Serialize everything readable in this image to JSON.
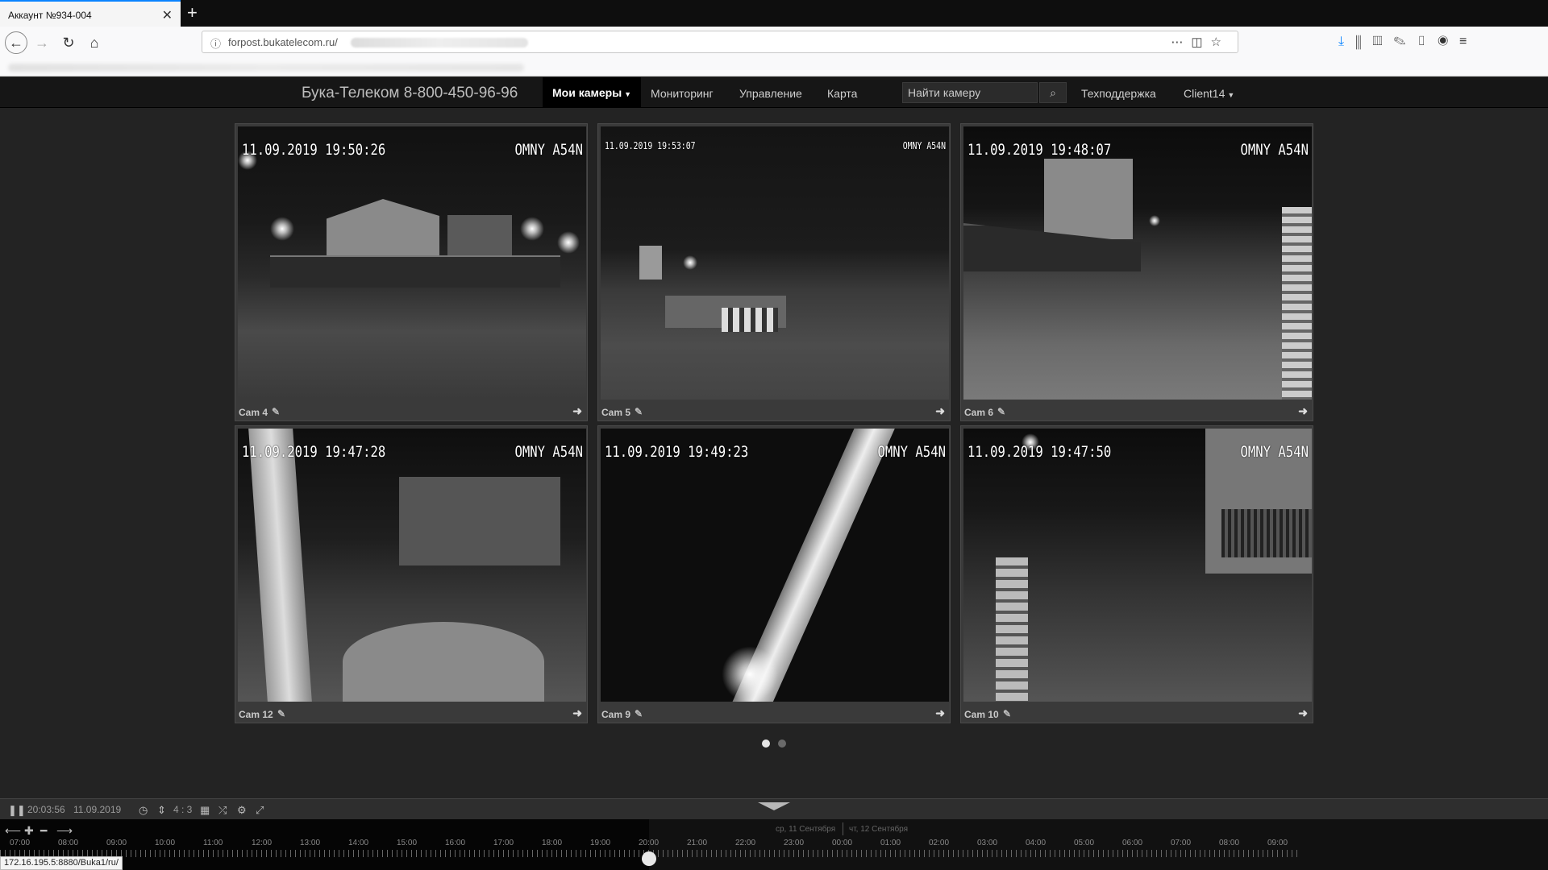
{
  "browser": {
    "tab_title": "Аккаунт №934-004",
    "tab_close": "✕",
    "new_tab": "+",
    "url": "forpost.bukatelecom.ru/",
    "icons": [
      "back-icon",
      "forward-icon",
      "reload-icon",
      "home-icon",
      "info-icon",
      "more-icon",
      "pocket-icon",
      "star-icon",
      "download-icon",
      "library-icon",
      "sidebar-icon",
      "extension-icon",
      "clipboard-icon",
      "account-icon",
      "menu-icon"
    ]
  },
  "navbar": {
    "brand": "Бука-Телеком 8-800-450-96-96",
    "my_cameras": "Мои камеры",
    "monitoring": "Мониторинг",
    "management": "Управление",
    "map": "Карта",
    "search_placeholder": "Найти камеру",
    "support": "Техподдержка",
    "user": "Client14"
  },
  "cameras": [
    {
      "name": "Cam 4",
      "timestamp": "11.09.2019 19:50:26",
      "model": "OMNY A54N"
    },
    {
      "name": "Cam 5",
      "timestamp": "11.09.2019 19:53:07",
      "model": "OMNY A54N"
    },
    {
      "name": "Cam 6",
      "timestamp": "11.09.2019 19:48:07",
      "model": "OMNY A54N"
    },
    {
      "name": "Cam 12",
      "timestamp": "11.09.2019 19:47:28",
      "model": "OMNY A54N"
    },
    {
      "name": "Cam 9",
      "timestamp": "11.09.2019 19:49:23",
      "model": "OMNY A54N"
    },
    {
      "name": "Cam 10",
      "timestamp": "11.09.2019 19:47:50",
      "model": "OMNY A54N"
    }
  ],
  "pager": {
    "pages": 2,
    "current": 1
  },
  "timeline": {
    "time": "20:03:56",
    "date": "11.09.2019",
    "aspect": "4 : 3",
    "day1": "ср, 11 Сентября",
    "day2": "чт, 12 Сентября",
    "hours": [
      "07:00",
      "08:00",
      "09:00",
      "10:00",
      "11:00",
      "12:00",
      "13:00",
      "14:00",
      "15:00",
      "16:00",
      "17:00",
      "18:00",
      "19:00",
      "20:00",
      "21:00",
      "22:00",
      "23:00",
      "00:00",
      "01:00",
      "02:00",
      "03:00",
      "04:00",
      "05:00",
      "06:00",
      "07:00",
      "08:00",
      "09:00"
    ]
  },
  "status_url": "172.16.195.5:8880/Buka1/ru/"
}
